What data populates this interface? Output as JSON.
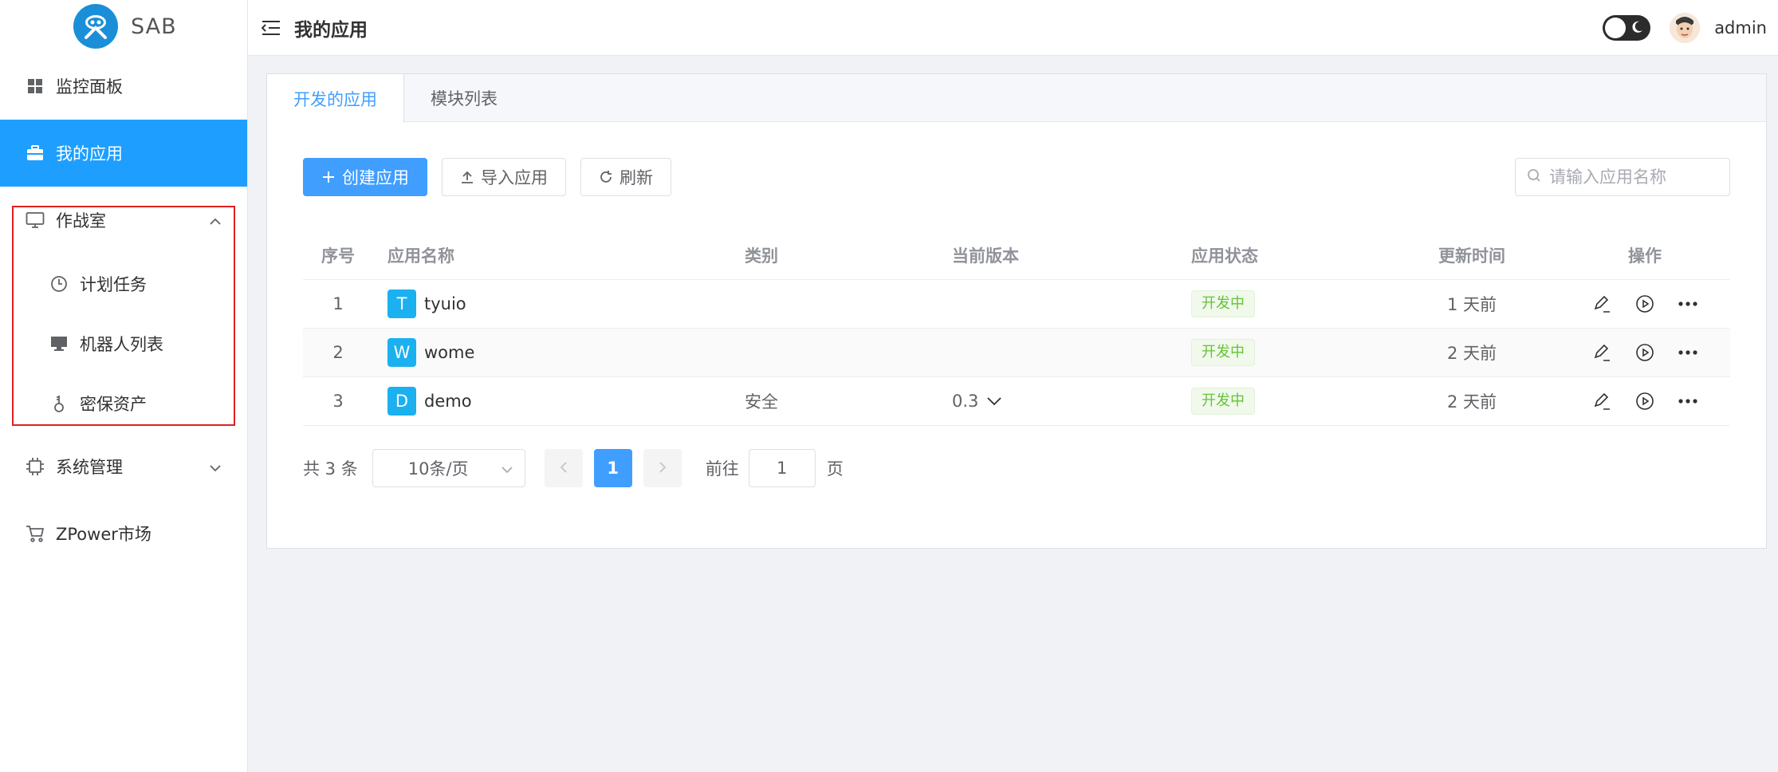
{
  "app": {
    "logo_text": "SAB"
  },
  "sidebar": {
    "items": [
      {
        "label": "监控面板",
        "icon": "dashboard-icon"
      },
      {
        "label": "我的应用",
        "icon": "briefcase-icon",
        "active": true
      },
      {
        "label": "作战室",
        "icon": "monitor-icon",
        "expanded": true,
        "children": [
          {
            "label": "计划任务",
            "icon": "clock-icon"
          },
          {
            "label": "机器人列表",
            "icon": "desktop-icon"
          },
          {
            "label": "密保资产",
            "icon": "key-icon"
          }
        ]
      },
      {
        "label": "系统管理",
        "icon": "cpu-icon",
        "expanded": false
      },
      {
        "label": "ZPower市场",
        "icon": "cart-icon"
      }
    ]
  },
  "header": {
    "title": "我的应用",
    "username": "admin"
  },
  "tabs": [
    {
      "label": "开发的应用",
      "active": true
    },
    {
      "label": "模块列表",
      "active": false
    }
  ],
  "toolbar": {
    "create_label": "创建应用",
    "import_label": "导入应用",
    "refresh_label": "刷新",
    "search_placeholder": "请输入应用名称"
  },
  "table": {
    "columns": [
      "序号",
      "应用名称",
      "类别",
      "当前版本",
      "应用状态",
      "更新时间",
      "操作"
    ],
    "rows": [
      {
        "idx": "1",
        "badge": "T",
        "name": "tyuio",
        "category": "",
        "version": "",
        "status": "开发中",
        "updated": "1 天前"
      },
      {
        "idx": "2",
        "badge": "W",
        "name": "wome",
        "category": "",
        "version": "",
        "status": "开发中",
        "updated": "2 天前"
      },
      {
        "idx": "3",
        "badge": "D",
        "name": "demo",
        "category": "安全",
        "version": "0.3",
        "status": "开发中",
        "updated": "2 天前"
      }
    ]
  },
  "pagination": {
    "total_label": "共 3 条",
    "page_size": "10条/页",
    "current_page": "1",
    "goto_label": "前往",
    "goto_value": "1",
    "goto_suffix": "页"
  },
  "colors": {
    "primary": "#409eff",
    "sidebar_active": "#1e9fff",
    "badge": "#1bb0f0",
    "status_green": "#67c23a",
    "highlight": "#e02020"
  }
}
